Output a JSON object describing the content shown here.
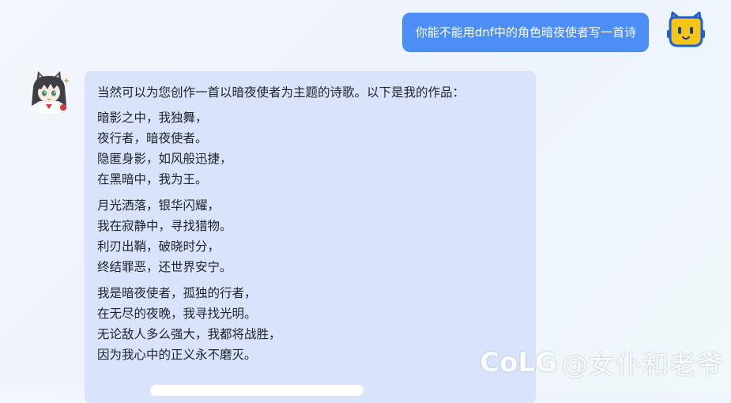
{
  "user": {
    "message": "你能不能用dnf中的角色暗夜使者写一首诗",
    "avatar_icon": "yellow-cat-avatar-icon"
  },
  "bot": {
    "avatar_icon": "anime-catgirl-avatar-icon",
    "intro": "当然可以为您创作一首以暗夜使者为主题的诗歌。以下是我的作品：",
    "stanzas": [
      [
        "暗影之中，我独舞，",
        "夜行者，暗夜使者。",
        "隐匿身影，如风般迅捷，",
        "在黑暗中，我为王。"
      ],
      [
        "月光洒落，银华闪耀，",
        "我在寂静中，寻找猎物。",
        "利刃出鞘，破晓时分，",
        "终结罪恶，还世界安宁。"
      ],
      [
        "我是暗夜使者，孤独的行者，",
        "在无尽的夜晚，我寻找光明。",
        "无论敌人多么强大，我都将战胜，",
        "因为我心中的正义永不磨灭。"
      ]
    ]
  },
  "watermark": {
    "logo": "CoLG",
    "text": "@女仆和老爷"
  },
  "colors": {
    "user_bubble": "#4c8df6",
    "bot_bubble": "#d9e4fc",
    "background": "#eef3fc"
  }
}
